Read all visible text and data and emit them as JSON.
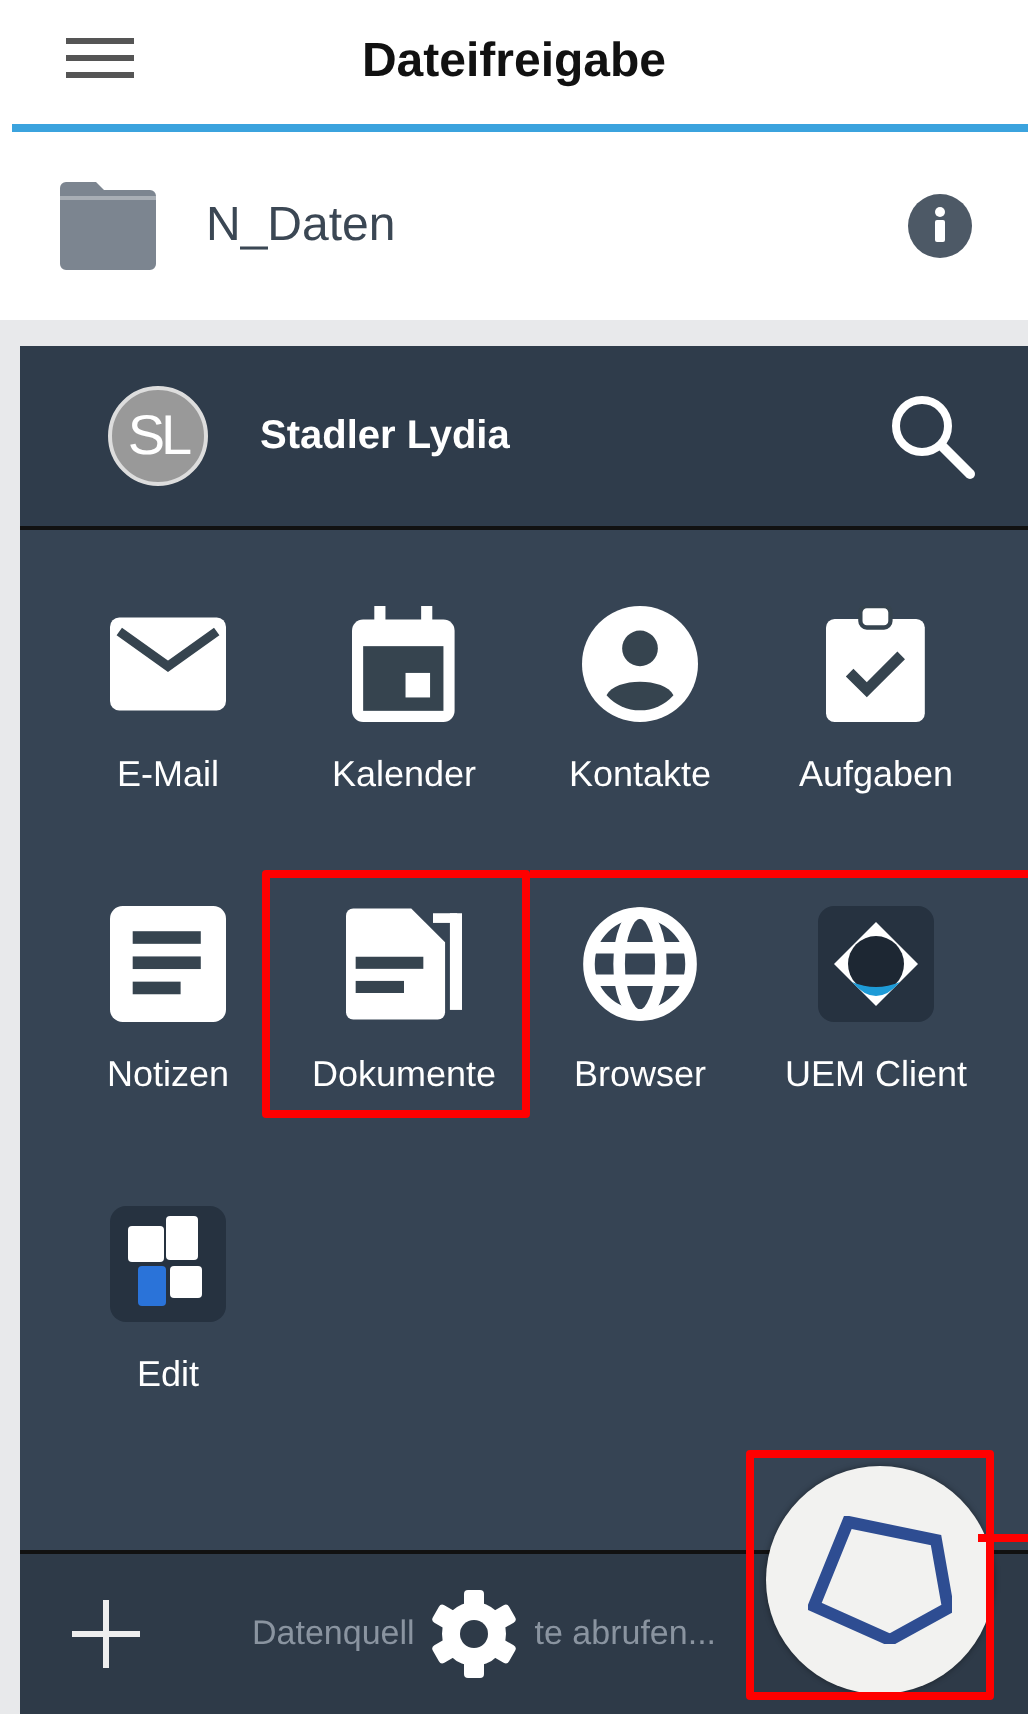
{
  "top_bar": {
    "title": "Dateifreigabe"
  },
  "folder": {
    "name": "N_Daten"
  },
  "drawer": {
    "user": {
      "initials": "SL",
      "name": "Stadler Lydia"
    },
    "apps": [
      {
        "label": "E-Mail",
        "kind": "mail",
        "highlighted": false
      },
      {
        "label": "Kalender",
        "kind": "calendar",
        "highlighted": false
      },
      {
        "label": "Kontakte",
        "kind": "contacts",
        "highlighted": false
      },
      {
        "label": "Aufgaben",
        "kind": "tasks",
        "highlighted": false
      },
      {
        "label": "Notizen",
        "kind": "notes",
        "highlighted": false
      },
      {
        "label": "Dokumente",
        "kind": "documents",
        "highlighted": true
      },
      {
        "label": "Browser",
        "kind": "browser",
        "highlighted": false
      },
      {
        "label": "UEM Client",
        "kind": "uem",
        "highlighted": false
      },
      {
        "label": "Edit",
        "kind": "edit",
        "highlighted": false
      }
    ],
    "status_text": [
      "Datenquell",
      "te abrufen..."
    ],
    "fab": {
      "highlighted": true
    }
  }
}
